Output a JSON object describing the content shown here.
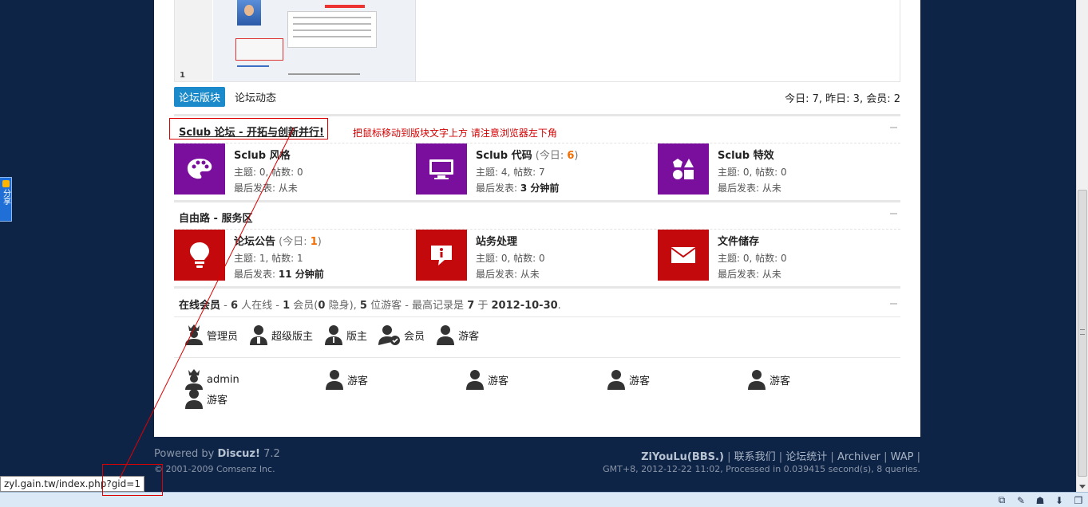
{
  "share_widget": {
    "label": "分享"
  },
  "tabs": [
    {
      "label": "论坛版块",
      "active": true
    },
    {
      "label": "论坛动态",
      "active": false
    }
  ],
  "preview": {
    "page": "1"
  },
  "day_stats": "今日: 7, 昨日: 3, 会员: 2",
  "annotation": {
    "text": "把鼠标移动到版块文字上方 请注意浏览器左下角"
  },
  "sections": [
    {
      "title": "Sclub 论坛 - 开拓与创新并行!",
      "forums": [
        {
          "name": "Sclub 风格",
          "today_prefix": "",
          "today": "",
          "today_suffix": "",
          "stats": "主题: 0, 帖数: 0",
          "last_label": "最后发表: ",
          "last": "从未",
          "last_bold": false,
          "icon": "palette-icon",
          "color": "#7a0f9e"
        },
        {
          "name": "Sclub 代码",
          "today_prefix": " (今日: ",
          "today": "6",
          "today_suffix": ")",
          "stats": "主题: 4, 帖数: 7",
          "last_label": "最后发表: ",
          "last": "3 分钟前",
          "last_bold": true,
          "icon": "monitor-icon",
          "color": "#7a0f9e"
        },
        {
          "name": "Sclub 特效",
          "today_prefix": "",
          "today": "",
          "today_suffix": "",
          "stats": "主题: 0, 帖数: 0",
          "last_label": "最后发表: ",
          "last": "从未",
          "last_bold": false,
          "icon": "shapes-icon",
          "color": "#7a0f9e"
        }
      ]
    },
    {
      "title": "自由路 - 服务区",
      "forums": [
        {
          "name": "论坛公告",
          "today_prefix": " (今日: ",
          "today": "1",
          "today_suffix": ")",
          "stats": "主题: 1, 帖数: 1",
          "last_label": "最后发表: ",
          "last": "11 分钟前",
          "last_bold": true,
          "icon": "lightbulb-icon",
          "color": "#c4090d"
        },
        {
          "name": "站务处理",
          "today_prefix": "",
          "today": "",
          "today_suffix": "",
          "stats": "主题: 0, 帖数: 0",
          "last_label": "最后发表: ",
          "last": "从未",
          "last_bold": false,
          "icon": "info-bubble-icon",
          "color": "#c4090d"
        },
        {
          "name": "文件储存",
          "today_prefix": "",
          "today": "",
          "today_suffix": "",
          "stats": "主题: 0, 帖数: 0",
          "last_label": "最后发表: ",
          "last": "从未",
          "last_bold": false,
          "icon": "envelope-icon",
          "color": "#c4090d"
        }
      ]
    }
  ],
  "online": {
    "title": "在线会员",
    "sep1": " - ",
    "total": "6",
    "t1": " 人在线 - ",
    "members": "1",
    "t2": " 会员(",
    "hidden": "0",
    "t3": " 隐身), ",
    "guests": "5",
    "t4": " 位游客 - 最高记录是 ",
    "record": "7",
    "t5": " 于 ",
    "record_date": "2012-10-30",
    "t6": "."
  },
  "legend": [
    "管理员",
    "超级版主",
    "版主",
    "会员",
    "游客"
  ],
  "users": [
    {
      "name": "admin",
      "role": "admin"
    },
    {
      "name": "游客",
      "role": "guest"
    },
    {
      "name": "游客",
      "role": "guest"
    },
    {
      "name": "游客",
      "role": "guest"
    },
    {
      "name": "游客",
      "role": "guest"
    },
    {
      "name": "游客",
      "role": "guest"
    }
  ],
  "footer": {
    "powered_prefix": "Powered by ",
    "powered_brand": "Discuz!",
    "powered_version": " 7.2",
    "copyright": "© 2001-2009 Comsenz Inc.",
    "site": "ZiYouLu(BBS.)",
    "links": [
      "联系我们",
      "论坛统计",
      "Archiver",
      "WAP"
    ],
    "processed": "GMT+8, 2012-12-22 11:02, Processed in 0.039415 second(s), 8 queries."
  },
  "status_url": "zyl.gain.tw/index.php?gid=1",
  "colors": {
    "background": "#0e2447",
    "tab_active": "#1a8acb",
    "forum_purple": "#7a0f9e",
    "forum_red": "#c4090d",
    "today_count": "#f26c00",
    "annotation": "#d40000"
  }
}
